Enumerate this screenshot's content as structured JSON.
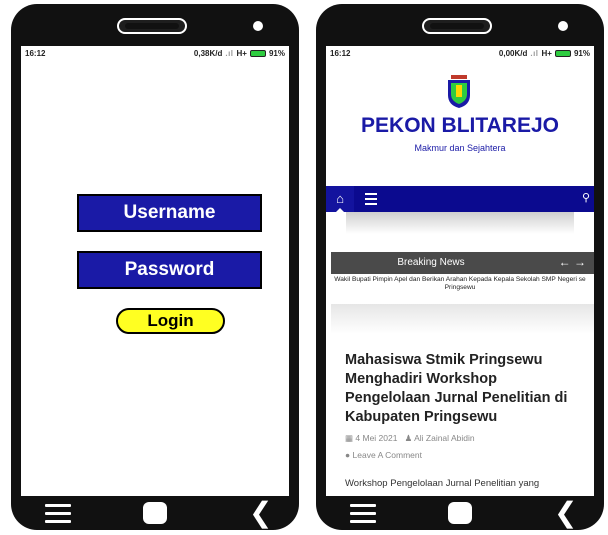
{
  "left_phone": {
    "status": {
      "time": "16:12",
      "speed": "0,38K/d",
      "network": "H+",
      "battery": "91%"
    },
    "login": {
      "username_label": "Username",
      "password_label": "Password",
      "button_label": "Login"
    }
  },
  "right_phone": {
    "status": {
      "time": "16:12",
      "speed": "0,00K/d",
      "network": "H+",
      "battery": "91%"
    },
    "site": {
      "title": "PEKON BLITAREJO",
      "tagline": "Makmur dan Sejahtera"
    },
    "breaking": {
      "label": "Breaking News",
      "arrows": "← →",
      "headline": "Wakil Bupati Pimpin Apel dan Berikan Arahan Kepada Kepala Sekolah SMP Negeri se Pringsewu"
    },
    "article": {
      "title": "Mahasiswa Stmik Pringsewu Menghadiri Workshop Pengelolaan Jurnal Penelitian di Kabupaten Pringsewu",
      "date": "4 Mei 2021",
      "author": "Ali Zainal Abidin",
      "comment_link": "Leave A Comment",
      "excerpt": "Workshop Pengelolaan Jurnal Penelitian yang"
    }
  },
  "colors": {
    "navy": "#1a1aa6",
    "menubar": "#0b0a8f",
    "login_button": "#ffff22",
    "breaking_bar": "#4a4a4a"
  },
  "icons": [
    "menu-icon",
    "home-icon",
    "back-icon",
    "search-icon",
    "calendar-icon",
    "user-icon",
    "comment-icon",
    "battery-icon",
    "logo-emblem"
  ]
}
